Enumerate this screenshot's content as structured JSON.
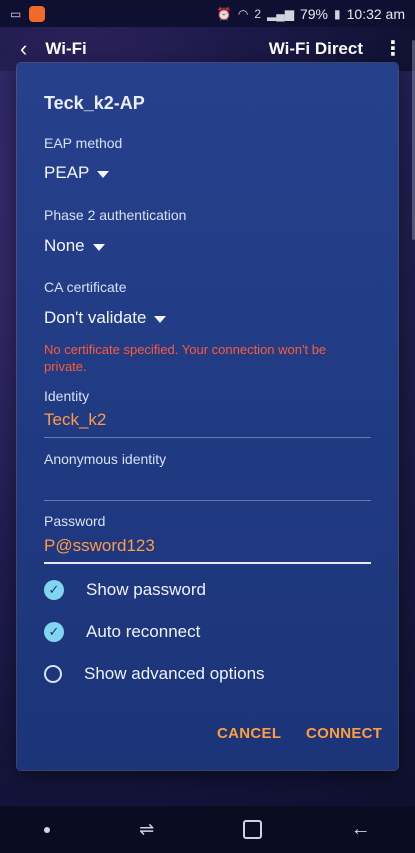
{
  "status_bar": {
    "battery": "79%",
    "time": "10:32 am",
    "sim_badge": "2"
  },
  "app_bar": {
    "title": "Wi-Fi",
    "action": "Wi-Fi Direct"
  },
  "dialog": {
    "network_name": "Teck_k2-AP",
    "eap_method_label": "EAP method",
    "eap_method_value": "PEAP",
    "phase2_label": "Phase 2 authentication",
    "phase2_value": "None",
    "ca_cert_label": "CA certificate",
    "ca_cert_value": "Don't validate",
    "warning": "No certificate specified. Your connection won't be private.",
    "identity_label": "Identity",
    "identity_value": "Teck_k2",
    "anonymous_label": "Anonymous identity",
    "anonymous_value": "",
    "password_label": "Password",
    "password_value": "P@ssword123",
    "options": [
      {
        "label": "Show password",
        "checked": true
      },
      {
        "label": "Auto reconnect",
        "checked": true
      },
      {
        "label": "Show advanced options",
        "checked": false
      }
    ],
    "cancel_label": "CANCEL",
    "connect_label": "CONNECT"
  },
  "colors": {
    "accent": "#ff9d3f",
    "error": "#ff5a3a",
    "dialog_bg": "#203a82",
    "check": "#7fd6ee"
  }
}
